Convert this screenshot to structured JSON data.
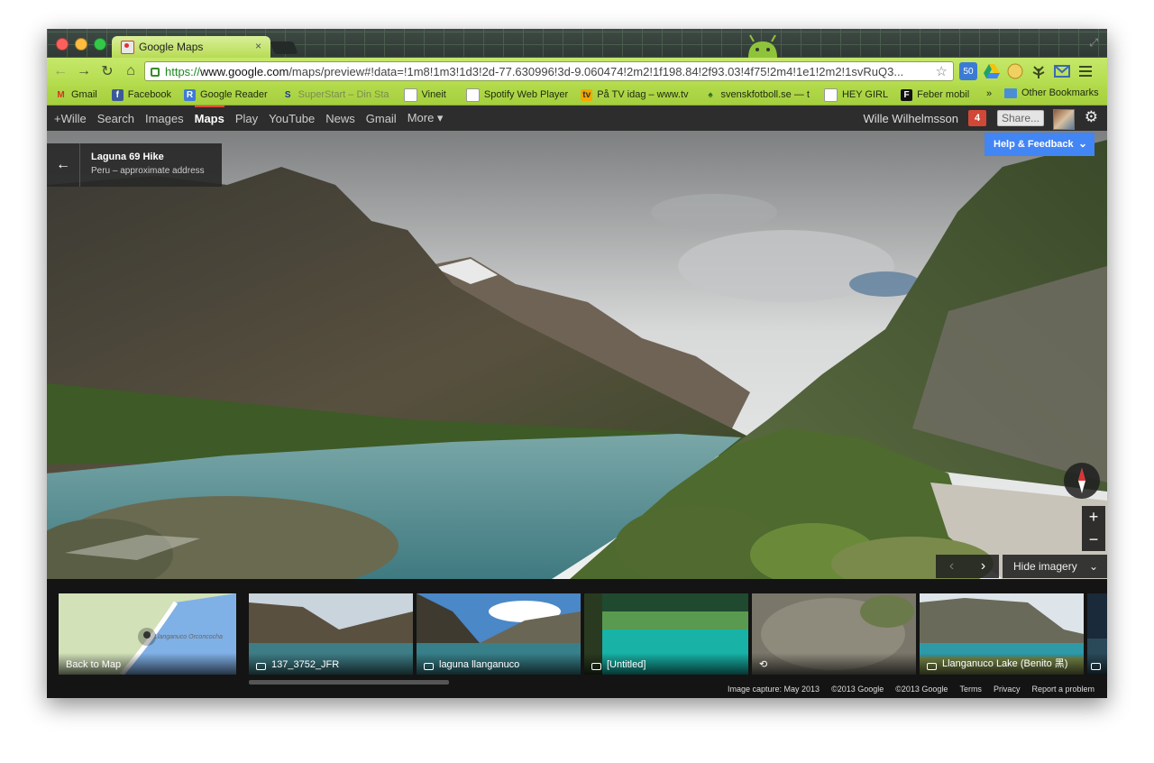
{
  "browser": {
    "tab_title": "Google Maps",
    "tab_close": "×",
    "url_scheme": "https://",
    "url_domain": "www.google.com",
    "url_path": "/maps/preview#!data=!1m8!1m3!1d3!2d-77.630996!3d-9.060474!2m2!1f198.84!2f93.03!4f75!2m4!1e1!2m2!1svRuQ3...",
    "extension_badge": "50",
    "colors": {
      "chrome_green": "#b7dc54",
      "close_light": "#fc605c",
      "minimize_light": "#fdbc40",
      "zoom_light": "#34c84a"
    }
  },
  "bookmarks": [
    {
      "label": "Gmail",
      "icon": "gmail-icon"
    },
    {
      "label": "Facebook",
      "icon": "facebook-icon"
    },
    {
      "label": "Google Reader",
      "icon": "reader-icon"
    },
    {
      "label": "SuperStart – Din Sta",
      "icon": "superstart-icon"
    },
    {
      "label": "Vineit",
      "icon": "page-icon"
    },
    {
      "label": "Spotify Web Player",
      "icon": "page-icon"
    },
    {
      "label": "På TV idag – www.tv",
      "icon": "tv-icon"
    },
    {
      "label": "svenskfotboll.se — t",
      "icon": "svff-icon"
    },
    {
      "label": "HEY GIRL",
      "icon": "page-icon"
    },
    {
      "label": "Feber mobil",
      "icon": "feber-icon"
    }
  ],
  "bookmarks_more": "»",
  "bookmarks_other": "Other Bookmarks",
  "gbar": {
    "links": [
      "+Wille",
      "Search",
      "Images",
      "Maps",
      "Play",
      "YouTube",
      "News",
      "Gmail",
      "More ▾"
    ],
    "active": "Maps",
    "user_name": "Wille Wilhelmsson",
    "notifications": "4",
    "share_label": "Share..."
  },
  "place": {
    "title": "Laguna 69 Hike",
    "subtitle": "Peru – approximate address"
  },
  "help_label": "Help & Feedback",
  "hide_imagery_label": "Hide imagery",
  "zoom": {
    "in": "+",
    "out": "−"
  },
  "filmstrip": {
    "map_thumb": {
      "label": "Back to Map",
      "map_text": "Llanganuco Orconcocha"
    },
    "photos": [
      {
        "caption": "137_3752_JFR"
      },
      {
        "caption": "laguna llanganuco"
      },
      {
        "caption": "[Untitled]"
      },
      {
        "caption": ""
      },
      {
        "caption": "Llanganuco Lake (Benito 黑)"
      }
    ]
  },
  "footer": [
    "Image capture: May 2013",
    "©2013 Google",
    "©2013 Google",
    "Terms",
    "Privacy",
    "Report a problem"
  ]
}
